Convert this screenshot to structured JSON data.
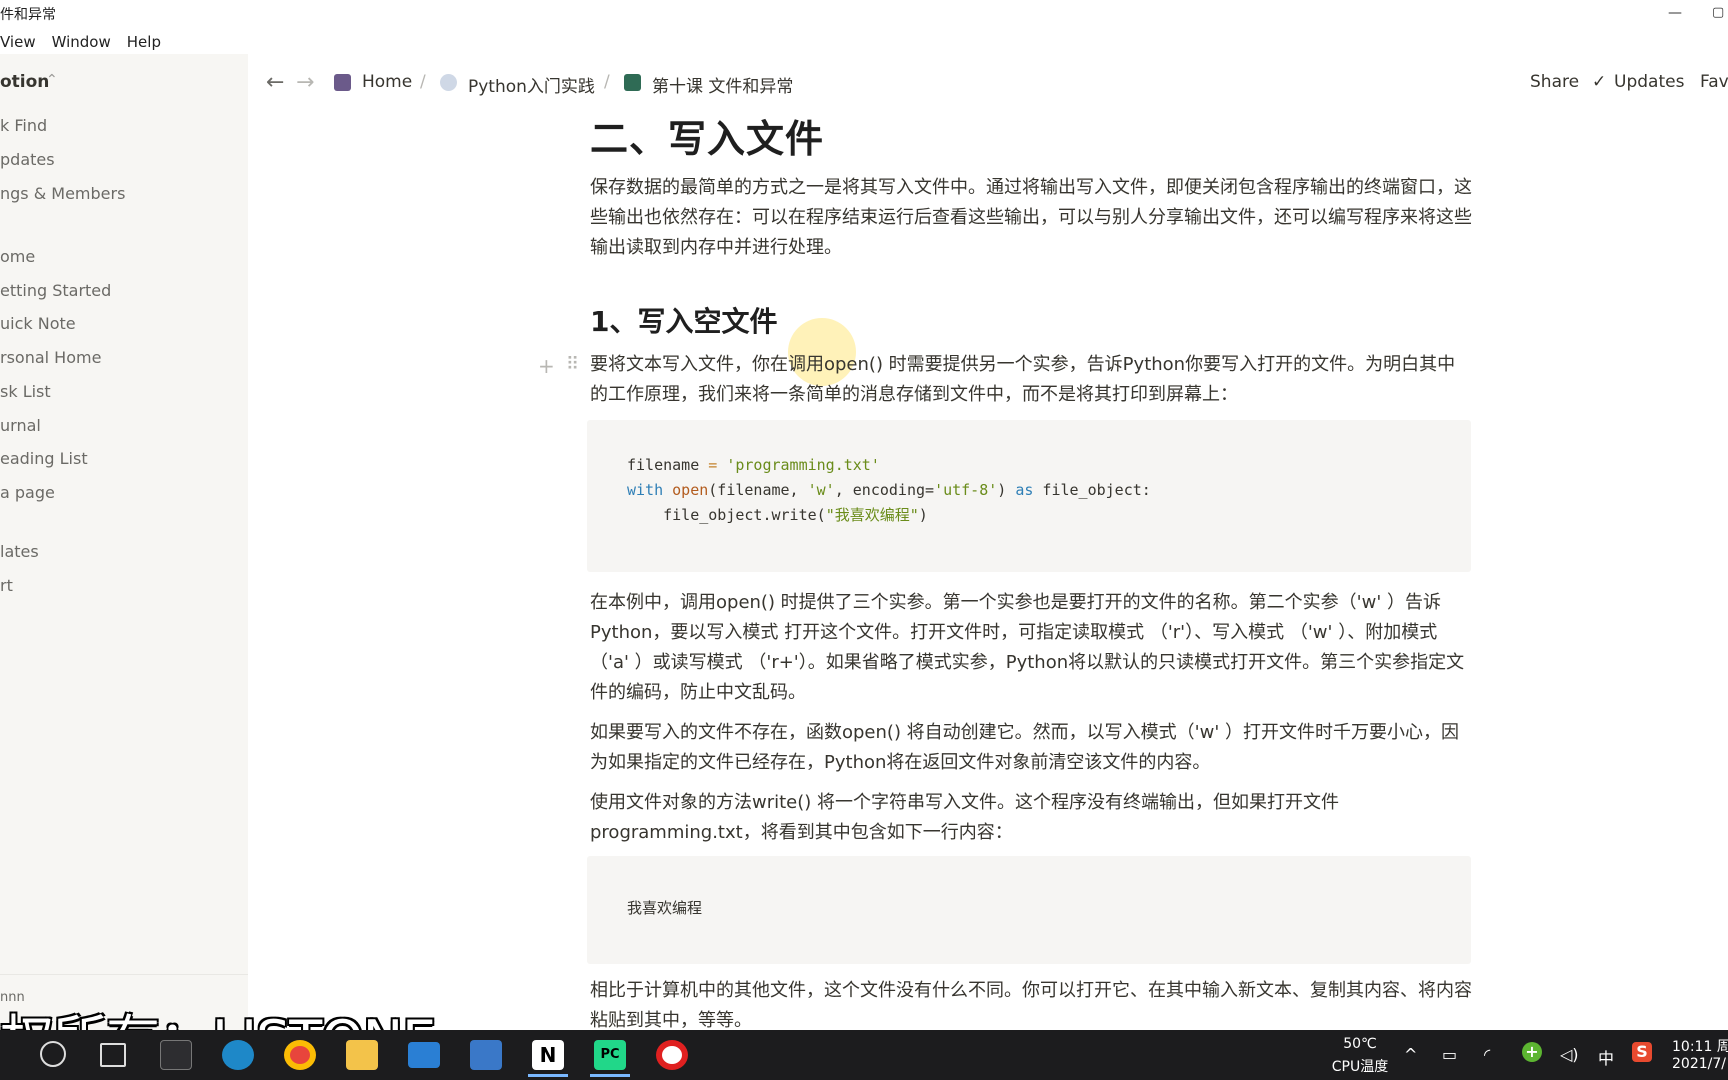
{
  "window": {
    "title": "件和异常",
    "minimize_glyph": "—",
    "restore_glyph": "▢"
  },
  "menu": [
    "View",
    "Window",
    "Help"
  ],
  "sidebar": {
    "workspace": "otion",
    "workspace_chevron": "⌃",
    "top_items": [
      "k Find",
      "pdates",
      "ngs & Members"
    ],
    "pages": [
      "ome",
      "etting Started",
      "uick Note",
      "rsonal Home",
      "sk List",
      "urnal",
      "eading List",
      "a page"
    ],
    "bottom_items": [
      "lates",
      "rt"
    ],
    "footer_partial": "nnn"
  },
  "topbar": {
    "back_icon": "←",
    "forward_icon": "→",
    "breadcrumb": [
      {
        "label": "Home"
      },
      {
        "label": "Python入门实践"
      },
      {
        "label": "第十课 文件和异常"
      }
    ],
    "separator": "/",
    "share": "Share",
    "updates": "Updates",
    "favorite_partial": "Fav",
    "check_icon": "✓"
  },
  "page": {
    "heading": "二、写入文件",
    "intro": "保存数据的最简单的方式之一是将其写入文件中。通过将输出写入文件，即便关闭包含程序输出的终端窗口，这些输出也依然存在：可以在程序结束运行后查看这些输出，可以与别人分享输出文件，还可以编写程序来将这些输出读取到内存中并进行处理。",
    "subheading": "1、写入空文件",
    "para1": "要将文本写入文件，你在调用open() 时需要提供另一个实参，告诉Python你要写入打开的文件。为明白其中的工作原理，我们来将一条简单的消息存储到文件中，而不是将其打印到屏幕上：",
    "block_add_icon": "+",
    "block_drag_icon": "⠿",
    "code1": {
      "line1": {
        "var": "filename",
        "op": " = ",
        "str": "'programming.txt'"
      },
      "line2": {
        "kw": "with",
        "fn": "open",
        "args_a": "(filename, ",
        "str_a": "'w'",
        "args_b": ", encoding=",
        "str_b": "'utf-8'",
        "args_c": ") ",
        "kw2": "as",
        "rest": " file_object:"
      },
      "line3": {
        "call": "    file_object.write(",
        "str": "\"我喜欢编程\"",
        "close": ")"
      }
    },
    "para2": "在本例中，调用open() 时提供了三个实参。第一个实参也是要打开的文件的名称。第二个实参（'w' ）告诉Python，要以写入模式 打开这个文件。打开文件时，可指定读取模式 （'r'）、写入模式 （'w' ）、附加模式 （'a' ）或读写模式 （'r+'）。如果省略了模式实参，Python将以默认的只读模式打开文件。第三个实参指定文件的编码，防止中文乱码。",
    "para3": "如果要写入的文件不存在，函数open() 将自动创建它。然而，以写入模式（'w' ）打开文件时千万要小心，因为如果指定的文件已经存在，Python将在返回文件对象前清空该文件的内容。",
    "para4": "使用文件对象的方法write() 将一个字符串写入文件。这个程序没有终端输出，但如果打开文件programming.txt，将看到其中包含如下一行内容：",
    "code2": "我喜欢编程",
    "para5": "相比于计算机中的其他文件，这个文件没有什么不同。你可以打开它、在其中输入新文本、复制其内容、将内容粘贴到其中，等等。"
  },
  "watermark": "权所有：LISTONE",
  "taskbar": {
    "apps": [
      "search",
      "task-view",
      "terminal",
      "edge",
      "chrome",
      "file-explorer",
      "mail",
      "store",
      "notion",
      "pycharm",
      "recorder"
    ],
    "notion_label": "N",
    "pycharm_label": "PC",
    "temperature": "50℃",
    "temperature_label": "CPU温度",
    "ime": "中",
    "time": "10:11 周",
    "date": "2021/7/",
    "tray_glyphs": {
      "up": "^",
      "battery": "▭",
      "wifi": "◜",
      "volume": "◁)",
      "sogou": "S",
      "plus": "+"
    }
  },
  "colors": {
    "sidebar_bg": "#f7f6f3",
    "code_bg": "#f6f5f3",
    "taskbar_bg": "#1c1c1e",
    "keyword": "#2f7fb6",
    "string": "#6a8c1a"
  }
}
